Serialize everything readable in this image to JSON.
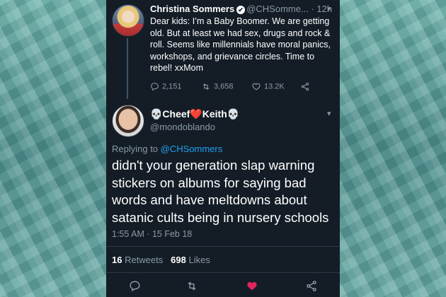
{
  "retweeted_tweet": {
    "author_name": "Christina Sommers",
    "handle": "@CHSomme...",
    "time": "· 12h",
    "text": "Dear kids: I’m a Baby Boomer. We are getting old. But at least we had sex, drugs and rock & roll. Seems like millennials have moral panics, workshops, and grievance circles. Time to rebel! xxMom",
    "replies": "2,151",
    "retweets": "3,658",
    "likes": "13.2K"
  },
  "reply_tweet": {
    "author_name": "💀Cheef❤️Keith💀",
    "handle": "@mondoblando",
    "replying_label": "Replying to ",
    "replying_to": "@CHSommers",
    "text": "didn't your generation slap warning stickers on albums for saying bad words and have meltdowns about satanic cults being in nursery schools",
    "timestamp": "1:55 AM · 15 Feb 18",
    "retweets_count": "16",
    "retweets_label": "Retweets",
    "likes_count": "698",
    "likes_label": "Likes"
  },
  "icons": {
    "verified": "verified-badge-icon",
    "reply": "reply-icon",
    "retweet": "retweet-icon",
    "like": "heart-icon",
    "share": "share-icon",
    "menu": "chevron-down-icon"
  },
  "colors": {
    "background": "#141d26",
    "link": "#1da1f2",
    "secondary_text": "#8899a6",
    "liked_heart": "#e0245e"
  }
}
